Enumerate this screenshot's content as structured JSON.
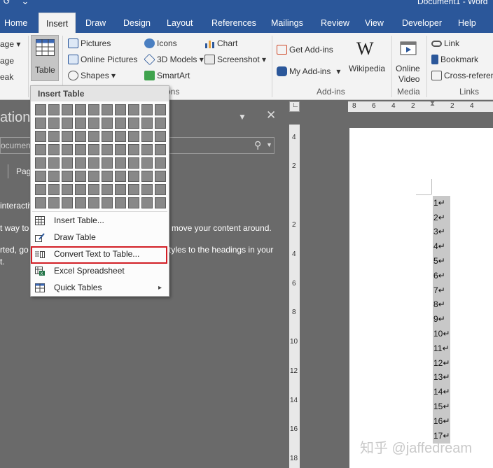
{
  "titlebar": {
    "qat": "↺ ⌄",
    "doc_title": "Document1 - Word"
  },
  "tabs": [
    "Home",
    "Insert",
    "Draw",
    "Design",
    "Layout",
    "References",
    "Mailings",
    "Review",
    "View",
    "Developer",
    "Help"
  ],
  "active_tab": "Insert",
  "ribbon": {
    "left_partial": [
      "age ▾",
      "age",
      "eak"
    ],
    "table_label": "Table",
    "illustrations": {
      "pictures": "Pictures",
      "online_pictures": "Online Pictures",
      "shapes": "Shapes ▾",
      "icons": "Icons",
      "models_3d": "3D Models ▾",
      "smartart": "SmartArt",
      "chart": "Chart",
      "screenshot": "Screenshot ▾",
      "group_label_partial": "tions"
    },
    "addins": {
      "get_addins": "Get Add-ins",
      "my_addins": "My Add-ins",
      "my_addins_arrow": "▾",
      "wikipedia": "Wikipedia",
      "group_label": "Add-ins"
    },
    "media": {
      "online_video_l1": "Online",
      "online_video_l2": "Video",
      "group_label": "Media"
    },
    "links": {
      "link": "Link",
      "bookmark": "Bookmark",
      "cross_reference": "Cross-referen",
      "group_label": "Links"
    }
  },
  "nav_pane": {
    "title_partial": "ation",
    "search_placeholder": "ocument",
    "tab_partial": "Pag",
    "text_lines": [
      "interactiv",
      "t way to",
      "rted, go",
      "t."
    ],
    "text_right": [
      "move your content around.",
      "tyles to the headings in your"
    ]
  },
  "dropdown": {
    "title": "Insert Table",
    "grid_rows": 8,
    "grid_cols": 10,
    "items": [
      {
        "label": "Insert Table...",
        "icon": "table-icon"
      },
      {
        "label": "Draw Table",
        "icon": "pencil-icon"
      },
      {
        "label": "Convert Text to Table...",
        "icon": "convert-icon",
        "highlighted": true
      },
      {
        "label": "Excel Spreadsheet",
        "icon": "excel-icon"
      },
      {
        "label": "Quick Tables",
        "icon": "quick-tables-icon",
        "has_submenu": true
      }
    ],
    "submenu_arrow": "▸"
  },
  "ruler_h_labels": [
    "8",
    "6",
    "4",
    "2",
    "2",
    "4"
  ],
  "ruler_v_labels": [
    "4",
    "2",
    "2",
    "4",
    "6",
    "8",
    "10",
    "12",
    "14",
    "16",
    "18"
  ],
  "document_lines": [
    "1↵",
    "2↵",
    "3↵",
    "4↵",
    "5↵",
    "6↵",
    "7↵",
    "8↵",
    "9↵",
    "10↵",
    "11↵",
    "12↵",
    "13↵",
    "14↵",
    "15↵",
    "16↵",
    "17↵"
  ],
  "watermark": "知乎 @jaffedream",
  "colors": {
    "brand": "#2b579a",
    "highlight_border": "#d21f26",
    "doc_selection": "#c8c8c8"
  }
}
